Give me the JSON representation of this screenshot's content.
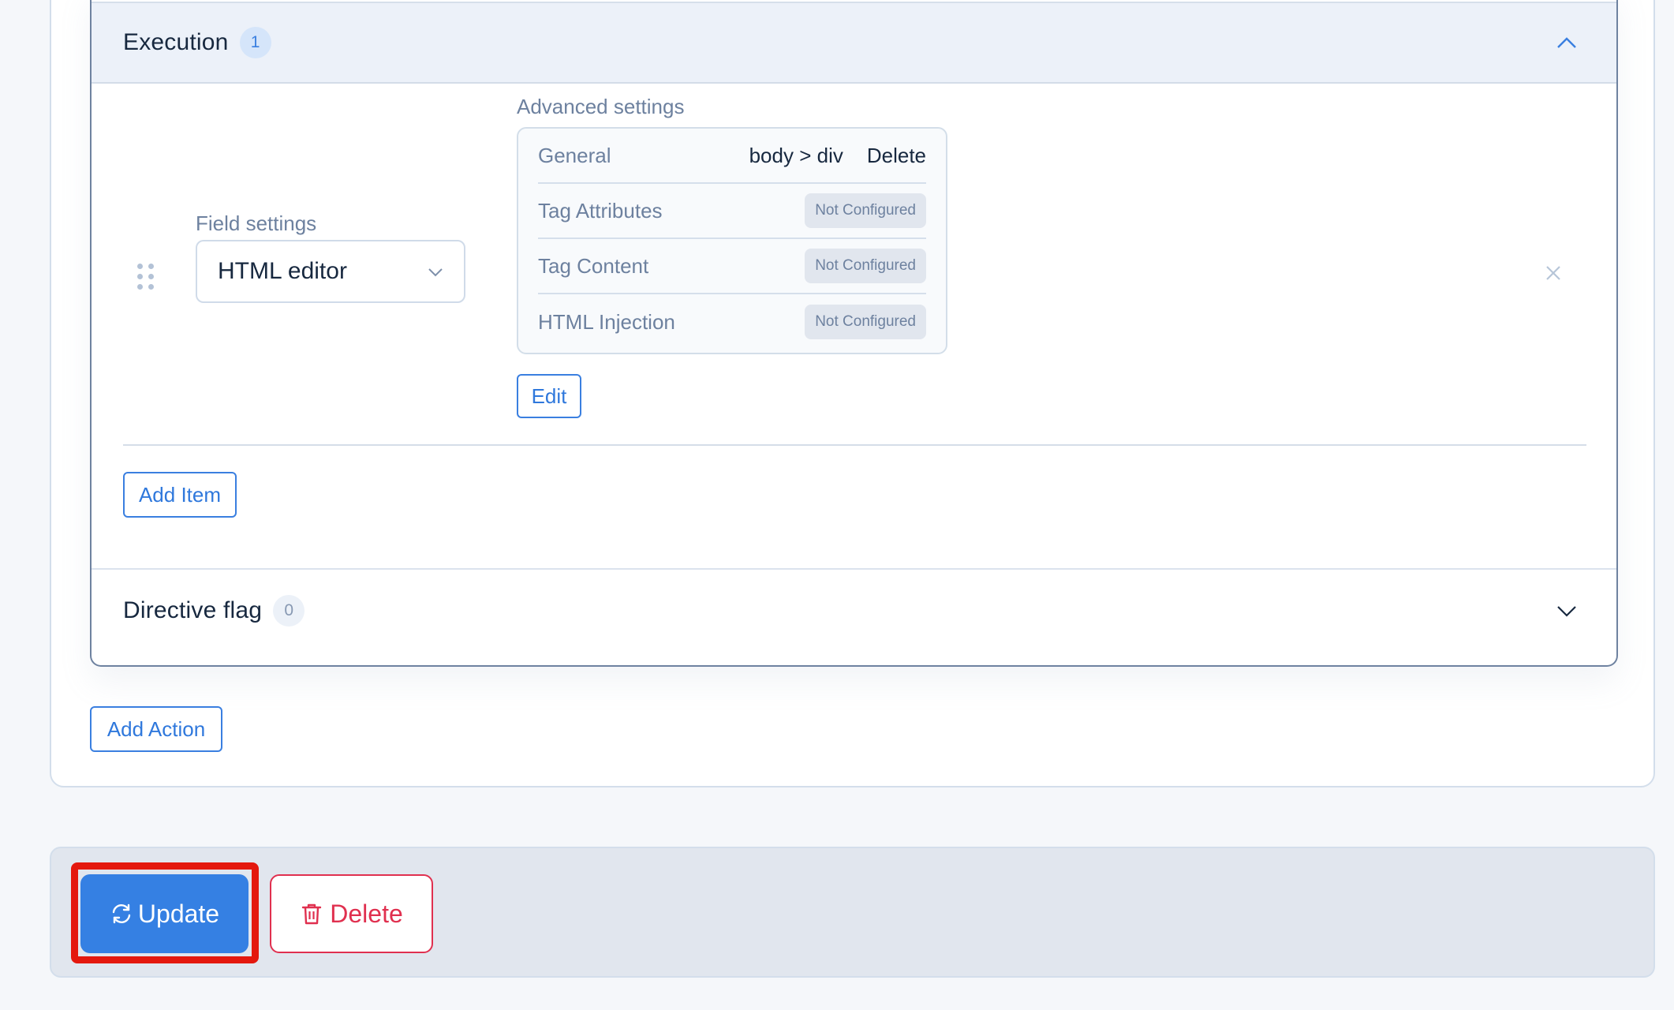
{
  "colors": {
    "primary": "#3580e3",
    "danger": "#e0304f",
    "highlight": "#e4180e"
  },
  "execution_section": {
    "title": "Execution",
    "count": "1",
    "expanded": true,
    "item": {
      "field_settings": {
        "label": "Field settings",
        "selected_value": "HTML editor"
      },
      "advanced_settings": {
        "label": "Advanced settings",
        "general_row": {
          "label": "General",
          "selector": "body > div",
          "delete_label": "Delete"
        },
        "rows": [
          {
            "label": "Tag Attributes",
            "status": "Not Configured"
          },
          {
            "label": "Tag Content",
            "status": "Not Configured"
          },
          {
            "label": "HTML Injection",
            "status": "Not Configured"
          }
        ],
        "edit_label": "Edit"
      }
    },
    "add_item_label": "Add Item"
  },
  "directive_section": {
    "title": "Directive flag",
    "count": "0",
    "expanded": false
  },
  "add_action_label": "Add Action",
  "footer": {
    "update_label": "Update",
    "delete_label": "Delete"
  }
}
